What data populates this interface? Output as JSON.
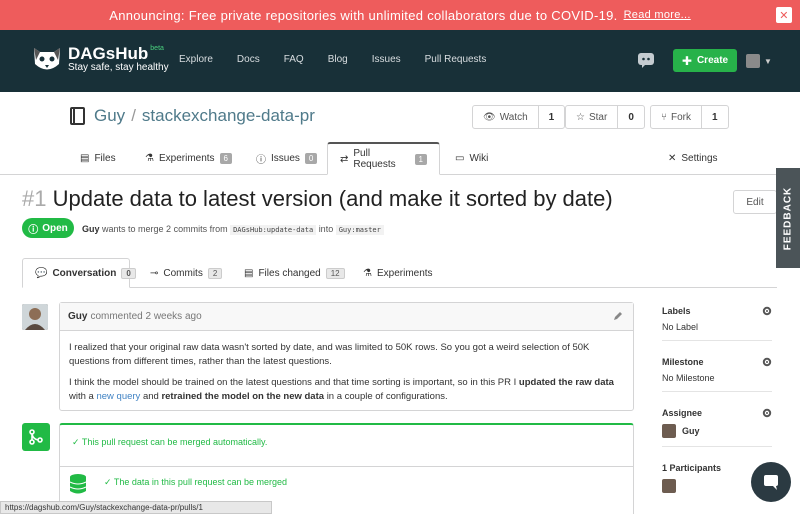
{
  "banner": {
    "text": "Announcing: Free private repositories with unlimited collaborators due to COVID-19.",
    "link": "Read more...",
    "close": "✕"
  },
  "nav": {
    "logo_name": "DAGsHub",
    "logo_beta": "beta",
    "logo_tag": "Stay safe, stay healthy",
    "links": [
      "Explore",
      "Docs",
      "FAQ",
      "Blog",
      "Issues",
      "Pull Requests"
    ],
    "create_label": "Create"
  },
  "repo": {
    "owner": "Guy",
    "name": "stackexchange-data-pr",
    "watch": {
      "label": "Watch",
      "count": "1"
    },
    "star": {
      "label": "Star",
      "count": "0"
    },
    "fork": {
      "label": "Fork",
      "count": "1"
    }
  },
  "tabs": {
    "files": "Files",
    "experiments": "Experiments",
    "experiments_count": "6",
    "issues": "Issues",
    "issues_count": "0",
    "pulls": "Pull Requests",
    "pulls_count": "1",
    "wiki": "Wiki",
    "settings": "Settings"
  },
  "pr": {
    "number": "#1",
    "title": "Update data to latest version (and make it sorted by date)",
    "edit": "Edit",
    "status": "Open",
    "author": "Guy",
    "meta_mid": "wants to merge 2 commits from",
    "from_branch": "DAGsHub:update-data",
    "into": "into",
    "to_branch": "Guy:master"
  },
  "subtabs": {
    "conversation": "Conversation",
    "conversation_count": "0",
    "commits": "Commits",
    "commits_count": "2",
    "files_changed": "Files changed",
    "files_changed_count": "12",
    "experiments": "Experiments"
  },
  "comment": {
    "author": "Guy",
    "when": "commented 2 weeks ago",
    "p1": "I realized that your original raw data wasn't sorted by date, and was limited to 50K rows. So you got a weird selection of 50K questions from different times, rather than the latest questions.",
    "p2_a": "I think the model should be trained on the latest questions and that time sorting is important, so in this PR I",
    "p2_b": "updated the raw data",
    "p2_c": "with a",
    "p2_link": "new query",
    "p2_d": "and",
    "p2_e": "retrained the model on the new data",
    "p2_f": "in a couple of configurations."
  },
  "merge": {
    "auto": "This pull request can be merged automatically.",
    "data": "The data in this pull request can be merged"
  },
  "sidebar": {
    "labels_h": "Labels",
    "labels_v": "No Label",
    "milestone_h": "Milestone",
    "milestone_v": "No Milestone",
    "assignee_h": "Assignee",
    "assignee_v": "Guy",
    "participants_h": "1 Participants"
  },
  "feedback": "FEEDBACK",
  "statusbar": "https://dagshub.com/Guy/stackexchange-data-pr/pulls/1",
  "colors": {
    "banner": "#ee5c5c",
    "nav": "#183038",
    "green": "#21ba45",
    "create": "#27b24a"
  }
}
